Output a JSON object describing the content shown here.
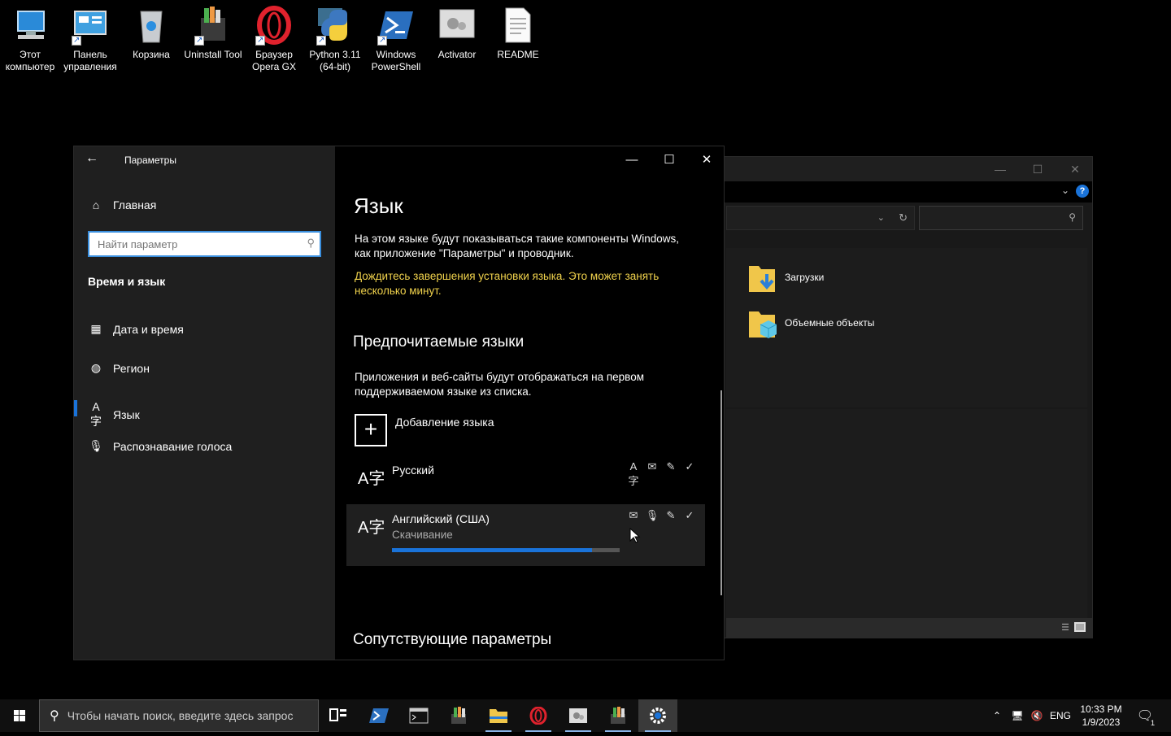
{
  "desktop": {
    "icons": [
      {
        "label": "Этот компьютер",
        "icon": "computer-icon"
      },
      {
        "label": "Панель управления",
        "icon": "control-panel-icon"
      },
      {
        "label": "Корзина",
        "icon": "recycle-bin-icon"
      },
      {
        "label": "Uninstall Tool",
        "icon": "uninstall-tool-icon"
      },
      {
        "label": "Браузер Opera GX",
        "icon": "opera-icon"
      },
      {
        "label": "Python 3.11 (64-bit)",
        "icon": "python-icon"
      },
      {
        "label": "Windows PowerShell",
        "icon": "powershell-icon"
      },
      {
        "label": "Activator",
        "icon": "activator-icon"
      },
      {
        "label": "README",
        "icon": "document-icon"
      }
    ]
  },
  "explorer": {
    "items": [
      {
        "label": "Загрузки",
        "icon": "downloads-folder-icon"
      },
      {
        "label": "Объемные объекты",
        "icon": "3d-objects-folder-icon"
      }
    ],
    "window_controls": {
      "minimize": "—",
      "maximize": "☐",
      "close": "✕"
    },
    "help": "?"
  },
  "settings": {
    "title": "Параметры",
    "sidebar": {
      "home": "Главная",
      "search_placeholder": "Найти параметр",
      "section": "Время и язык",
      "items": [
        {
          "label": "Дата и время",
          "icon": "calendar-clock-icon"
        },
        {
          "label": "Регион",
          "icon": "globe-icon"
        },
        {
          "label": "Язык",
          "icon": "language-icon",
          "active": true
        },
        {
          "label": "Распознавание голоса",
          "icon": "microphone-icon"
        }
      ]
    },
    "main": {
      "heading": "Язык",
      "description": "На этом языке будут показываться такие компоненты Windows, как приложение \"Параметры\" и проводник.",
      "warning": "Дождитесь завершения установки языка. Это может занять несколько минут.",
      "preferred_heading": "Предпочитаемые языки",
      "preferred_desc": "Приложения и веб-сайты будут отображаться на первом поддерживаемом языке из списка.",
      "add_language": "Добавление языка",
      "languages": [
        {
          "name": "Русский",
          "status": "",
          "features": [
            "display-language-icon",
            "text-to-speech-icon",
            "handwriting-icon",
            "spellcheck-icon"
          ]
        },
        {
          "name": "Английский (США)",
          "status": "Скачивание",
          "progress": 0.88,
          "features": [
            "text-to-speech-icon",
            "microphone-icon",
            "handwriting-icon",
            "spellcheck-icon"
          ]
        }
      ],
      "related_heading": "Сопутствующие параметры"
    },
    "window_controls": {
      "minimize": "—",
      "maximize": "☐",
      "close": "✕"
    }
  },
  "taskbar": {
    "search_placeholder": "Чтобы начать поиск, введите здесь запрос",
    "language": "ENG",
    "time": "10:33 PM",
    "date": "1/9/2023",
    "notification_count": "1",
    "accent": "#1a73d9"
  }
}
